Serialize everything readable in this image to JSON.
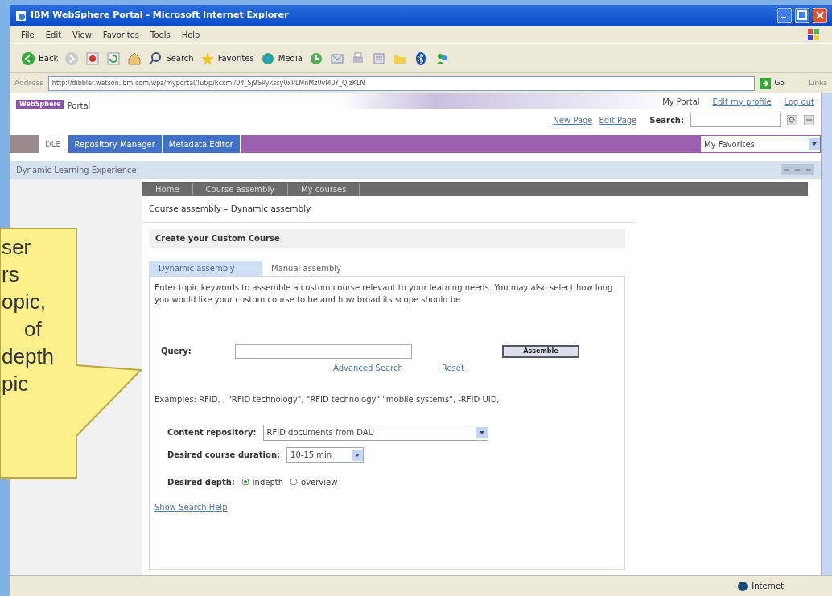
{
  "window": {
    "title": "IBM WebSphere Portal - Microsoft Internet Explorer"
  },
  "menu": [
    "File",
    "Edit",
    "View",
    "Favorites",
    "Tools",
    "Help"
  ],
  "toolbar": [
    {
      "kind": "back",
      "label": "Back"
    },
    {
      "kind": "forward"
    },
    {
      "kind": "stop"
    },
    {
      "kind": "refresh"
    },
    {
      "kind": "home"
    },
    {
      "kind": "search",
      "label": "Search"
    },
    {
      "kind": "favorites",
      "label": "Favorites"
    },
    {
      "kind": "media",
      "label": "Media"
    },
    {
      "kind": "history"
    },
    {
      "kind": "mail"
    },
    {
      "kind": "print"
    },
    {
      "kind": "edit"
    },
    {
      "kind": "folder"
    },
    {
      "kind": "bluetooth"
    },
    {
      "kind": "messenger"
    }
  ],
  "address": {
    "label": "Address",
    "url": "http://dibbler.watson.ibm.com/wps/myportal/!ut/p/kcxml/04_Sj9SPykssy0xPLMnMz0vM0Y_QjzKLN",
    "go": "Go",
    "links": "Links"
  },
  "portal": {
    "logo": "WebSphere",
    "logo_text": "Portal",
    "header_links": [
      "My Portal",
      "Edit my profile",
      "Log out"
    ],
    "page_links": [
      "New Page",
      "Edit Page"
    ],
    "search_label": "Search:"
  },
  "nav_tabs": [
    {
      "label": "DLE",
      "selected": true
    },
    {
      "label": "Repository Manager",
      "selected": false
    },
    {
      "label": "Metadata Editor",
      "selected": false
    }
  ],
  "favorites": "My Favorites",
  "portlet_title": "Dynamic Learning Experience",
  "app_nav": [
    "Home",
    "Course assembly",
    "My courses"
  ],
  "breadcrumb": "Course assembly – Dynamic assembly",
  "panel_title": "Create your Custom Course",
  "mode_tabs": [
    {
      "label": "Dynamic assembly",
      "selected": true
    },
    {
      "label": "Manual assembly",
      "selected": false
    }
  ],
  "intro": "Enter topic keywords to assemble a custom course relevant to your learning needs. You may also select how long you would like your custom course to be and how broad its scope should be.",
  "query": {
    "label": "Query:",
    "button": "Assemble"
  },
  "query_links": [
    "Advanced Search",
    "Reset"
  ],
  "examples": "Examples: RFID, , \"RFID technology\", \"RFID technology\" \"mobile systems\", -RFID UID,",
  "fields": [
    {
      "label": "Content repository:",
      "value": "RFID documents from DAU"
    },
    {
      "label": "Desired course duration:",
      "value": "10-15 min"
    }
  ],
  "depth": {
    "label": "Desired depth:",
    "options": [
      {
        "label": "indepth",
        "selected": true
      },
      {
        "label": "overview",
        "selected": false
      }
    ]
  },
  "help_link": "Show Search Help",
  "status": "Internet",
  "callout": [
    "ser",
    "rs",
    "opic,",
    "of",
    "depth",
    "pic"
  ]
}
